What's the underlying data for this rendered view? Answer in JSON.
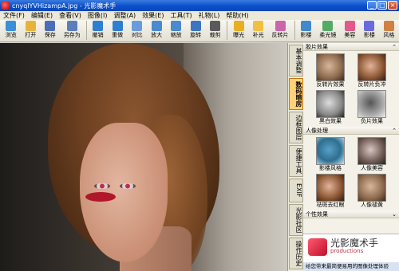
{
  "window": {
    "title": "cnyqlYVHizampA.jpg - 光影魔术手"
  },
  "menu": [
    "文件(F)",
    "编辑(E)",
    "查看(V)",
    "图像(I)",
    "调整(A)",
    "效果(E)",
    "工具(T)",
    "礼物(L)",
    "帮助(H)"
  ],
  "toolbar": [
    {
      "label": "浏览",
      "icon": "folder-icon",
      "color": "#3a8fd6"
    },
    {
      "label": "打开",
      "icon": "open-icon",
      "color": "#e9b33a"
    },
    {
      "label": "保存",
      "icon": "save-icon",
      "color": "#4a6fb8"
    },
    {
      "label": "另存为",
      "icon": "save-as-icon",
      "color": "#5b7dbe"
    },
    {
      "label": "撤销",
      "icon": "undo-icon",
      "color": "#2f7fd0"
    },
    {
      "label": "重做",
      "icon": "redo-icon",
      "color": "#2f7fd0"
    },
    {
      "label": "对比",
      "icon": "compare-icon",
      "color": "#6a9be0"
    },
    {
      "label": "放大",
      "icon": "zoom-in-icon",
      "color": "#4a8ad0"
    },
    {
      "label": "缩放",
      "icon": "zoom-icon",
      "color": "#4a8ad0"
    },
    {
      "label": "旋转",
      "icon": "rotate-icon",
      "color": "#3c76c0"
    },
    {
      "label": "裁剪",
      "icon": "crop-icon",
      "color": "#5a5a5a"
    },
    {
      "label": "曝光",
      "icon": "exposure-icon",
      "color": "#e8b020"
    },
    {
      "label": "补光",
      "icon": "fill-light-icon",
      "color": "#f0c040"
    },
    {
      "label": "反转片",
      "icon": "reversal-film-icon",
      "color": "#cc66aa"
    },
    {
      "label": "影楼",
      "icon": "studio-icon",
      "color": "#4488cc"
    },
    {
      "label": "柔光镜",
      "icon": "soft-focus-icon",
      "color": "#55aa66"
    },
    {
      "label": "美容",
      "icon": "beauty-icon",
      "color": "#e05a8a"
    },
    {
      "label": "影楼",
      "icon": "studio2-icon",
      "color": "#6a6ae0"
    },
    {
      "label": "风格",
      "icon": "style-icon",
      "color": "#d08040"
    }
  ],
  "sidetabs": [
    {
      "label": "基本调整",
      "active": false
    },
    {
      "label": "数码暗房",
      "active": true
    },
    {
      "label": "边框图层",
      "active": false
    },
    {
      "label": "便捷工具",
      "active": false
    },
    {
      "label": "EXIF",
      "active": false
    },
    {
      "label": "光影社区",
      "active": false
    },
    {
      "label": "操作历史",
      "active": false
    }
  ],
  "panel": {
    "sections": [
      {
        "title": "胶片效果",
        "items": [
          {
            "label": "反转片效果",
            "style": "sepia"
          },
          {
            "label": "反转片负冲",
            "style": "color"
          },
          {
            "label": "黑白效果",
            "style": "bw"
          },
          {
            "label": "负片效果",
            "style": "negbw"
          }
        ]
      },
      {
        "title": "人像处理",
        "items": [
          {
            "label": "影楼风格",
            "style": "neg"
          },
          {
            "label": "人像美容",
            "style": "cool"
          },
          {
            "label": "祛斑去红眼",
            "style": "color"
          },
          {
            "label": "人像褪黄",
            "style": "sepia"
          }
        ]
      },
      {
        "title": "个性效果",
        "items": []
      }
    ]
  },
  "ad": {
    "name": "光影魔术手",
    "sub": "productions",
    "bar": "给您带来最简便易用的图像处理体验"
  }
}
